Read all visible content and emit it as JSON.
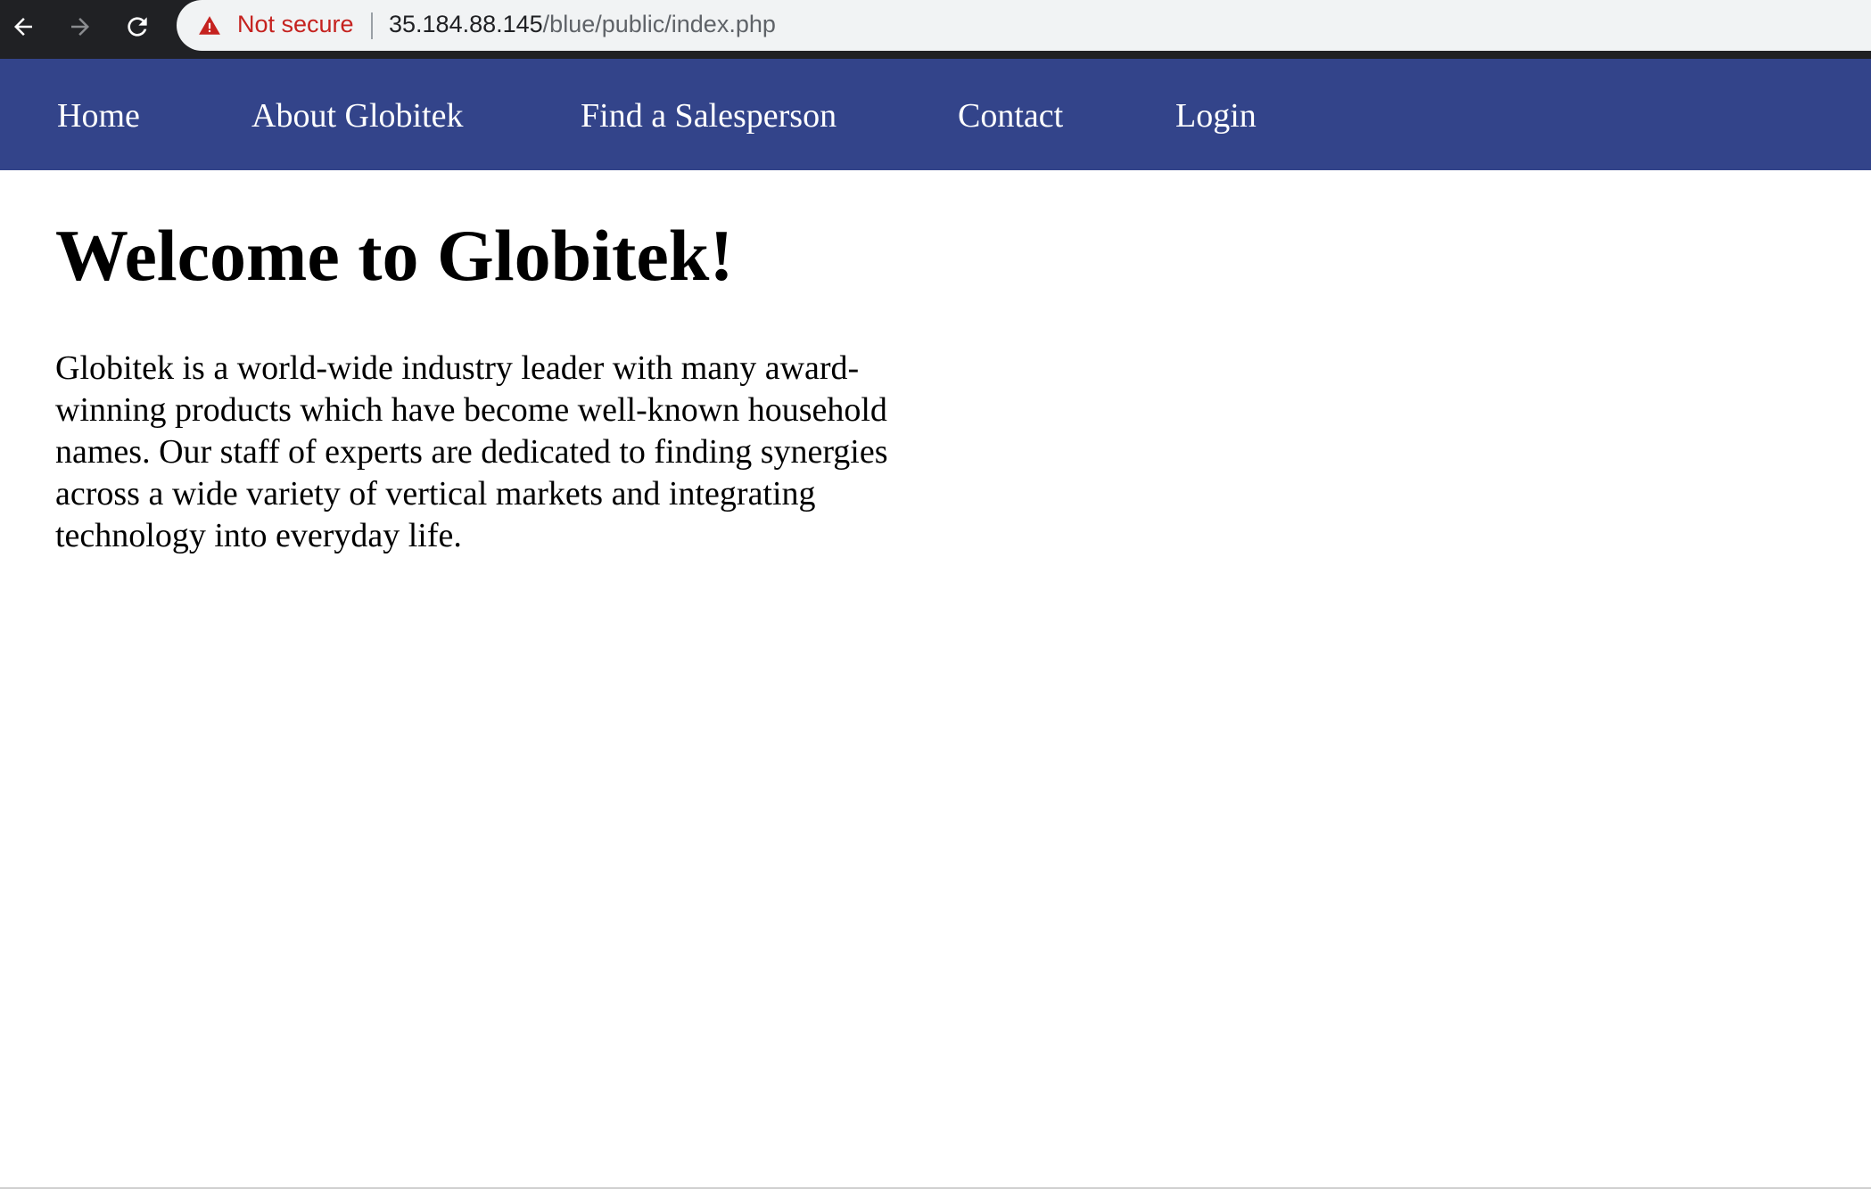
{
  "browser": {
    "icons": {
      "back": "arrow-left-icon",
      "forward": "arrow-right-icon",
      "reload": "reload-icon",
      "security": "warning-triangle-icon"
    },
    "security_label": "Not secure",
    "url_host": "35.184.88.145",
    "url_path": "/blue/public/index.php",
    "colors": {
      "chrome_bg": "#202124",
      "omnibox_bg": "#f1f3f4",
      "warning": "#c5221f"
    }
  },
  "site_nav": {
    "background": "#33448a",
    "items": [
      {
        "label": "Home"
      },
      {
        "label": "About Globitek"
      },
      {
        "label": "Find a Salesperson"
      },
      {
        "label": "Contact"
      },
      {
        "label": "Login"
      }
    ]
  },
  "main": {
    "title": "Welcome to Globitek!",
    "intro": "Globitek is a world-wide industry leader with many award-winning products which have become well-known household names. Our staff of experts are dedicated to finding synergies across a wide variety of vertical markets and integrating technology into everyday life."
  }
}
